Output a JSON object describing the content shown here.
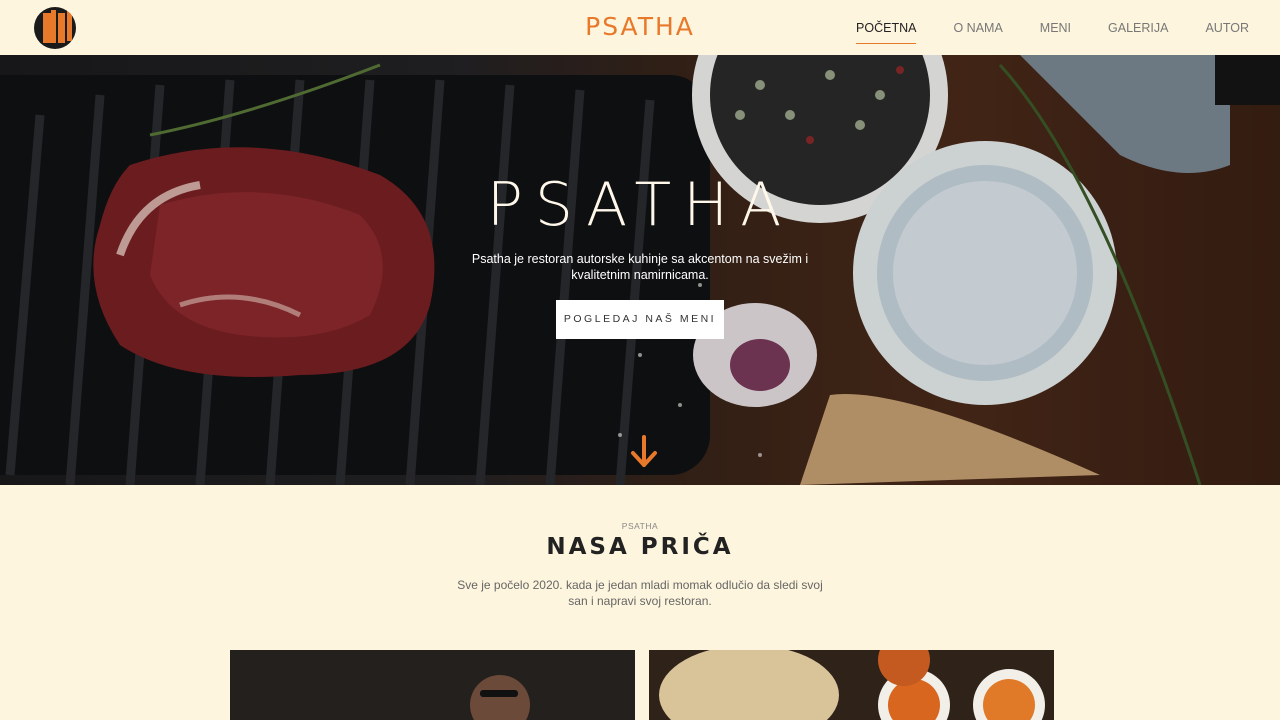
{
  "header": {
    "brand": "PSATHA",
    "nav": [
      "POČETNA",
      "O NAMA",
      "MENI",
      "GALERIJA",
      "AUTOR"
    ],
    "active_nav": "POČETNA",
    "accent_color": "#e8782a"
  },
  "hero": {
    "title": "PSATHA",
    "subtitle": "Psatha je restoran autorske kuhinje sa akcentom na svežim i kvalitetnim namirnicama.",
    "cta_label": "POGLEDAJ NAŠ MENI",
    "scroll_icon": "arrow-down-icon"
  },
  "story": {
    "kicker": "PSATHA",
    "title": "NASA PRIČA",
    "text": "Sve je počelo 2020. kada je jedan mladi momak odlučio da sledi svoj san i napravi svoj restoran."
  }
}
